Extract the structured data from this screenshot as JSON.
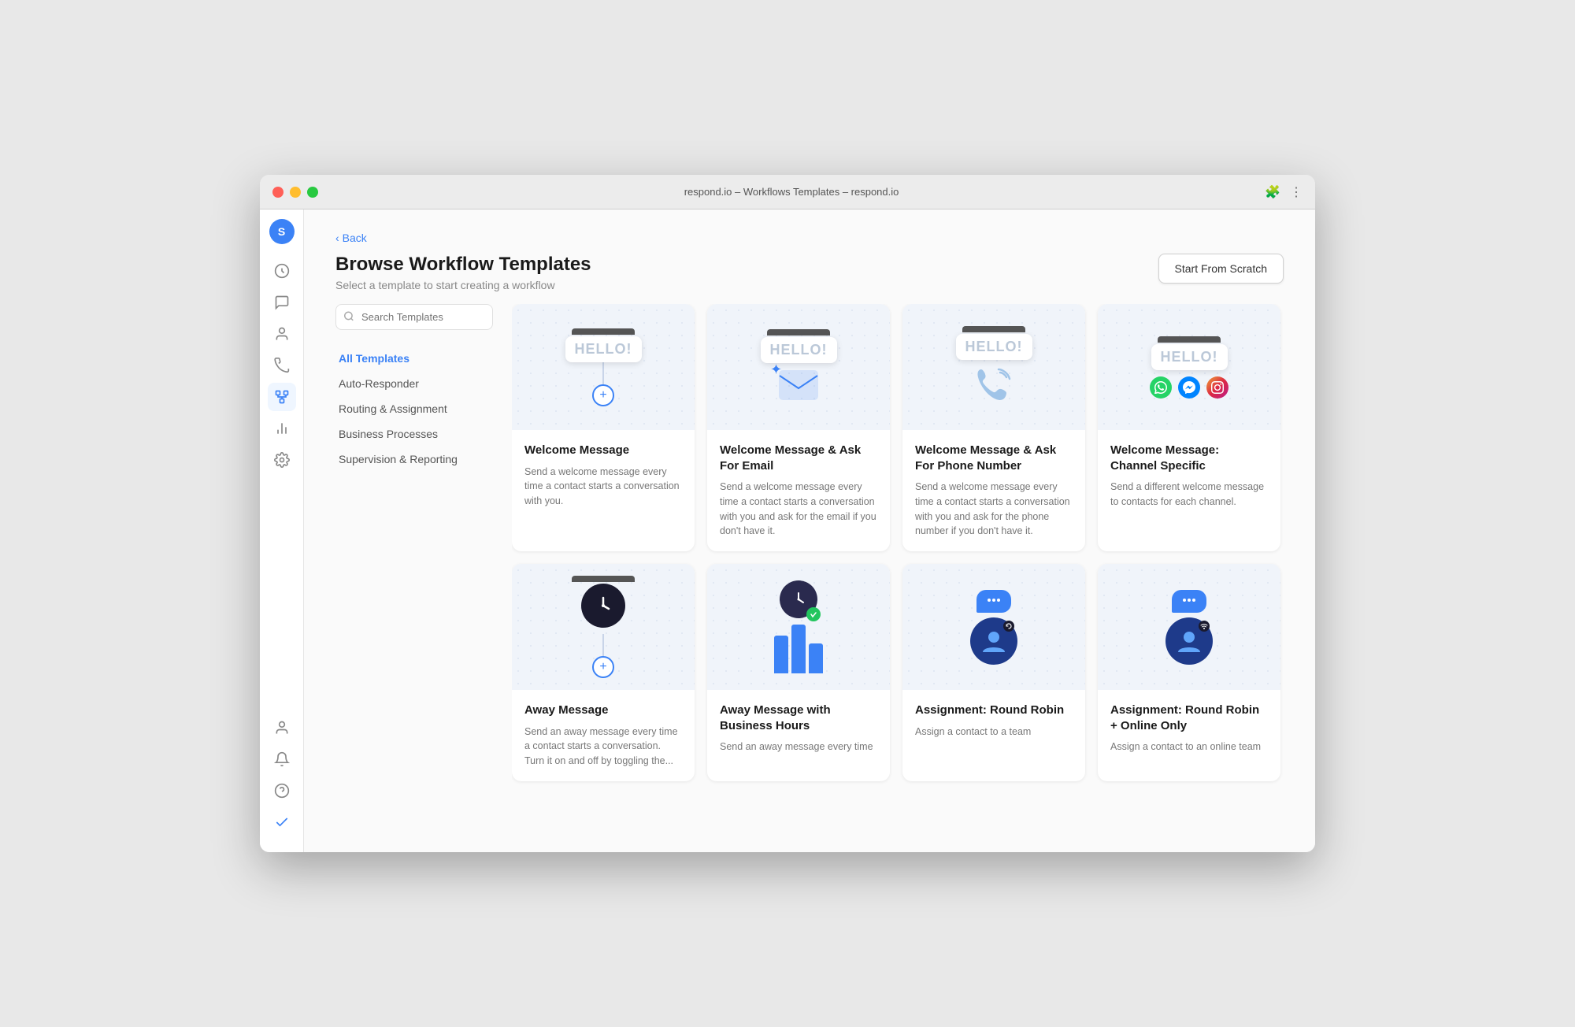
{
  "window": {
    "title": "respond.io – Workflows Templates – respond.io"
  },
  "back": {
    "label": "Back"
  },
  "header": {
    "title": "Browse Workflow Templates",
    "subtitle": "Select a template to start creating a workflow",
    "start_scratch": "Start From Scratch"
  },
  "search": {
    "placeholder": "Search Templates"
  },
  "filters": [
    {
      "id": "all",
      "label": "All Templates",
      "active": true
    },
    {
      "id": "auto-responder",
      "label": "Auto-Responder",
      "active": false
    },
    {
      "id": "routing",
      "label": "Routing & Assignment",
      "active": false
    },
    {
      "id": "business",
      "label": "Business Processes",
      "active": false
    },
    {
      "id": "supervision",
      "label": "Supervision & Reporting",
      "active": false
    }
  ],
  "templates": [
    {
      "id": "welcome",
      "title": "Welcome Message",
      "description": "Send a welcome message every time a contact starts a conversation with you.",
      "type": "welcome"
    },
    {
      "id": "welcome-email",
      "title": "Welcome Message & Ask For Email",
      "description": "Send a welcome message every time a contact starts a conversation with you and ask for the email if you don't have it.",
      "type": "welcome-email"
    },
    {
      "id": "welcome-phone",
      "title": "Welcome Message & Ask For Phone Number",
      "description": "Send a welcome message every time a contact starts a conversation with you and ask for the phone number if you don't have it.",
      "type": "welcome-phone"
    },
    {
      "id": "welcome-channel",
      "title": "Welcome Message: Channel Specific",
      "description": "Send a different welcome message to contacts for each channel.",
      "type": "welcome-channel"
    },
    {
      "id": "away",
      "title": "Away Message",
      "description": "Send an away message every time a contact starts a conversation. Turn it on and off by toggling the...",
      "type": "away"
    },
    {
      "id": "away-hours",
      "title": "Away Message with Business Hours",
      "description": "Send an away message every time",
      "type": "away-hours"
    },
    {
      "id": "round-robin",
      "title": "Assignment: Round Robin",
      "description": "Assign a contact to a team",
      "type": "round-robin"
    },
    {
      "id": "round-robin-online",
      "title": "Assignment: Round Robin + Online Only",
      "description": "Assign a contact to an online team",
      "type": "round-robin-online"
    }
  ],
  "sidebar_icons": [
    {
      "id": "dashboard",
      "icon": "⚡",
      "active": false
    },
    {
      "id": "chat",
      "icon": "💬",
      "active": false
    },
    {
      "id": "contacts",
      "icon": "👤",
      "active": false
    },
    {
      "id": "broadcast",
      "icon": "📡",
      "active": false
    },
    {
      "id": "workflows",
      "icon": "⑂",
      "active": true
    },
    {
      "id": "reports",
      "icon": "📊",
      "active": false
    },
    {
      "id": "settings",
      "icon": "⚙",
      "active": false
    }
  ],
  "bottom_icons": [
    {
      "id": "profile",
      "icon": "👤"
    },
    {
      "id": "notifications",
      "icon": "🔔"
    },
    {
      "id": "help",
      "icon": "❓"
    },
    {
      "id": "tasks",
      "icon": "✔"
    }
  ]
}
